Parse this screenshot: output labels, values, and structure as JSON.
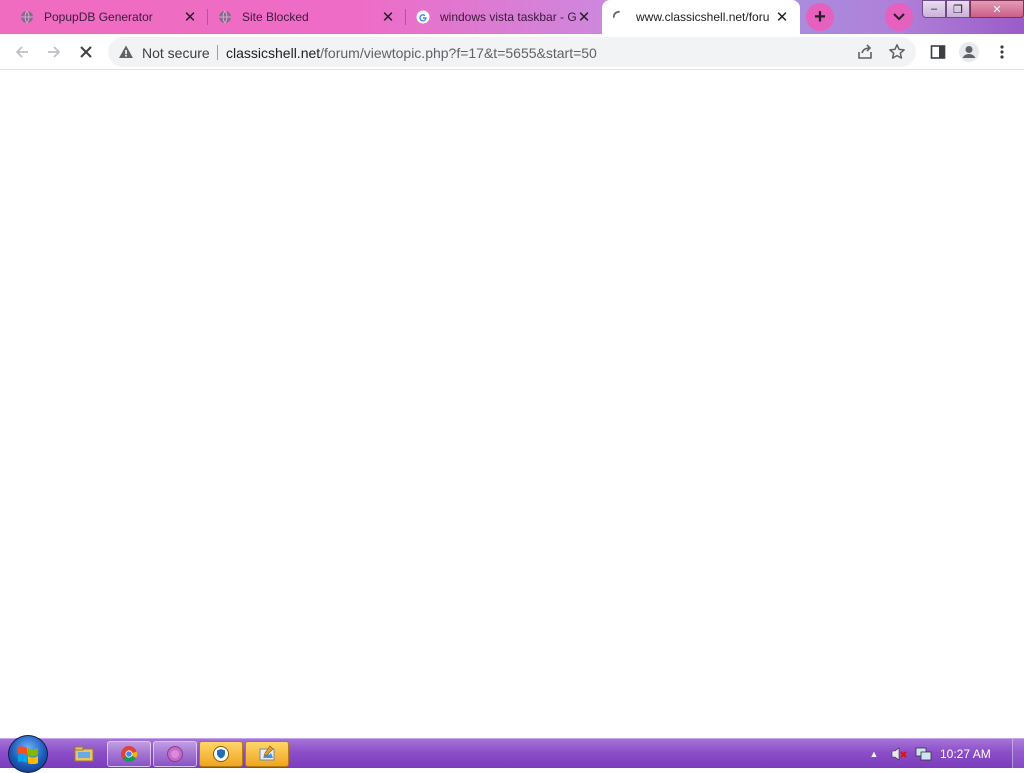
{
  "browser": {
    "tabs": [
      {
        "title": "PopupDB Generator",
        "favicon": "globe-icon"
      },
      {
        "title": "Site Blocked",
        "favicon": "globe-icon"
      },
      {
        "title": "windows vista taskbar - G",
        "favicon": "google-icon"
      },
      {
        "title": "www.classicshell.net/foru",
        "favicon": "loading-spinner-icon",
        "active": true
      }
    ],
    "new_tab_label": "+",
    "address_bar": {
      "security_label": "Not secure",
      "url_host": "classicshell.net",
      "url_path": "/forum/viewtopic.php?f=17&t=5655&start=50"
    },
    "window_controls": {
      "minimize": "–",
      "maximize": "❐",
      "close": "✕"
    }
  },
  "taskbar": {
    "apps": [
      {
        "name": "file-explorer-icon"
      },
      {
        "name": "chrome-icon"
      },
      {
        "name": "circle-app-icon"
      },
      {
        "name": "hotspot-shield-icon"
      },
      {
        "name": "paint-icon"
      }
    ],
    "tray": {
      "overflow_label": "▲",
      "clock": "10:27 AM"
    }
  },
  "colors": {
    "tabstrip_left": "#f06cc0",
    "tabstrip_right": "#9a5cc8",
    "taskbar": "#8c4fc8"
  }
}
